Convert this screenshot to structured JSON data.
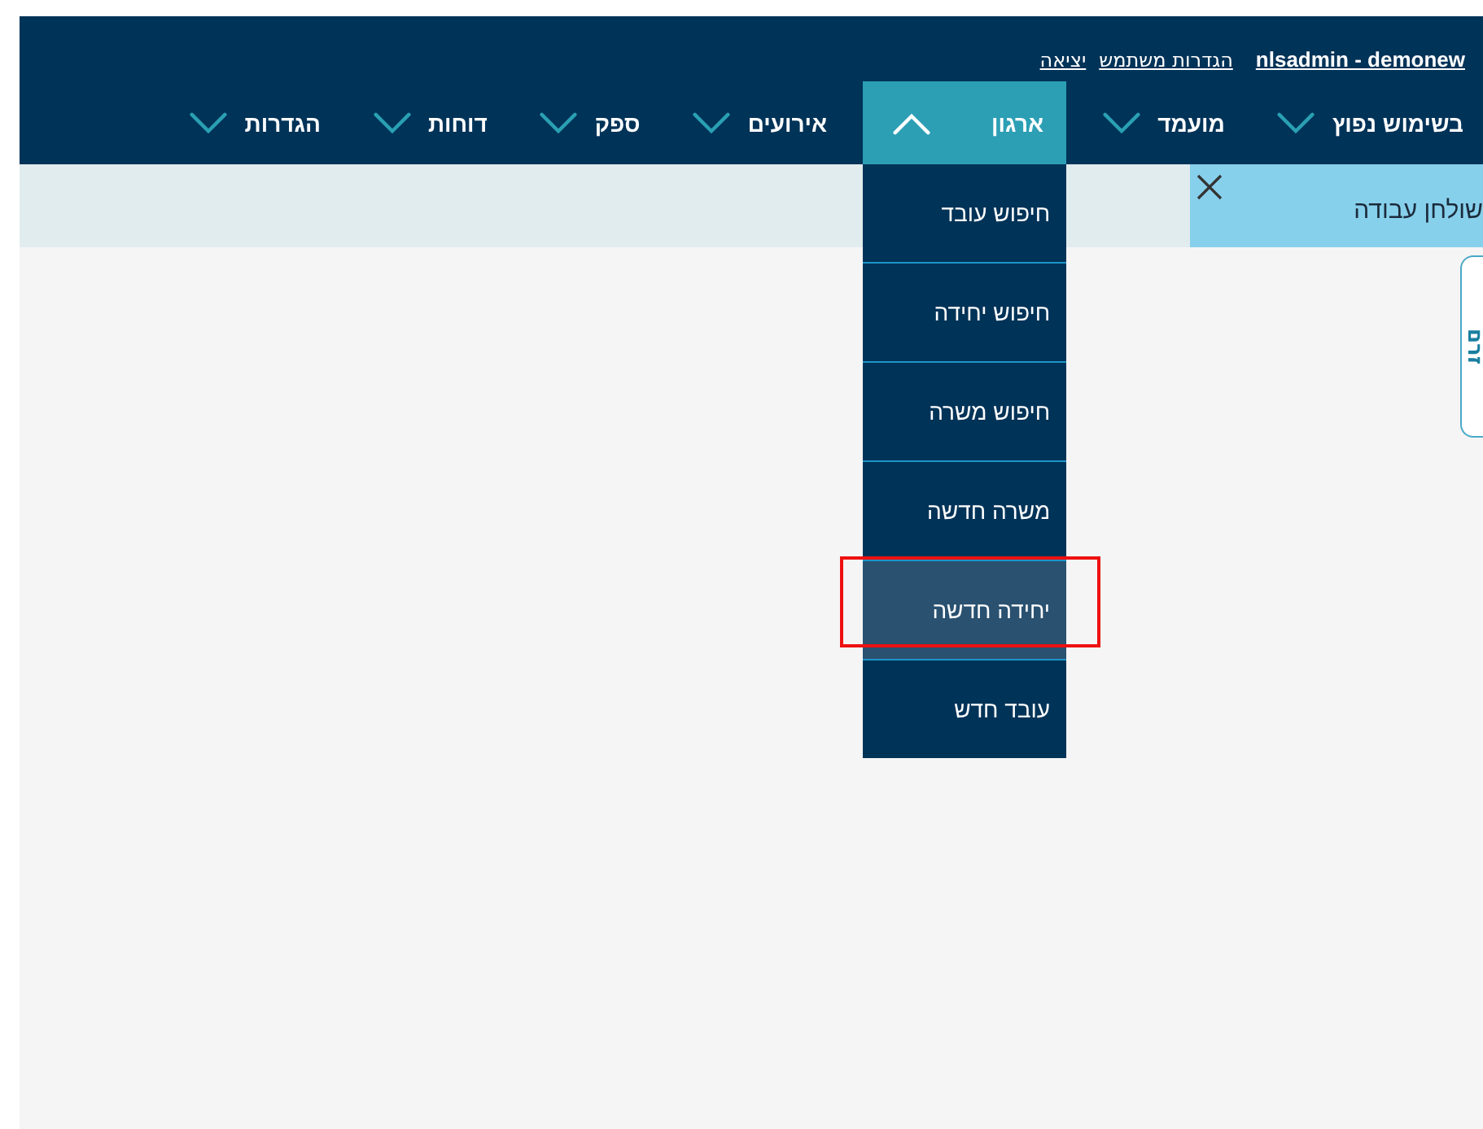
{
  "header": {
    "user": "nlsadmin - demonew",
    "links": [
      "הגדרות משתמש",
      "יציאה"
    ]
  },
  "nav": [
    {
      "label": "בשימוש נפוץ",
      "expanded": false
    },
    {
      "label": "מועמד",
      "expanded": false
    },
    {
      "label": "ארגון",
      "expanded": true,
      "menu": [
        {
          "label": "חיפוש עובד",
          "highlighted": false
        },
        {
          "label": "חיפוש יחידה",
          "highlighted": false
        },
        {
          "label": "חיפוש משרה",
          "highlighted": false
        },
        {
          "label": "משרה חדשה",
          "highlighted": false
        },
        {
          "label": "יחידה חדשה",
          "highlighted": true
        },
        {
          "label": "עובד חדש",
          "highlighted": false
        }
      ]
    },
    {
      "label": "אירועים",
      "expanded": false
    },
    {
      "label": "ספק",
      "expanded": false
    },
    {
      "label": "דוחות",
      "expanded": false
    },
    {
      "label": "הגדרות",
      "expanded": false
    }
  ],
  "work_tabs": [
    {
      "label": "שולחן עבודה",
      "selected": true
    }
  ],
  "side_tab": {
    "label": "זרם"
  }
}
